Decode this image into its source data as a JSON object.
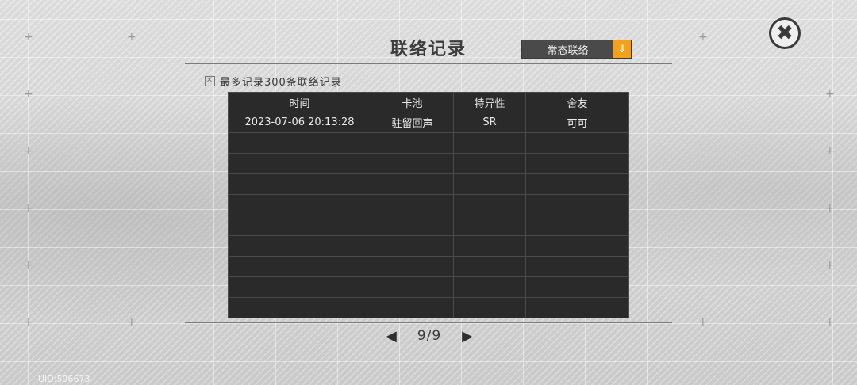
{
  "window": {
    "title": "联络记录"
  },
  "dropdown": {
    "selected": "常态联络",
    "arrow": "⇓"
  },
  "close": {
    "glyph": "✖"
  },
  "note": {
    "checkbox": "✕",
    "text": "最多记录300条联络记录"
  },
  "table": {
    "headers": [
      "时间",
      "卡池",
      "特异性",
      "舍友"
    ],
    "rows": [
      {
        "time": "2023-07-06 20:13:28",
        "pool": "驻留回声",
        "rarity": "SR",
        "roommate": "可可"
      }
    ],
    "empty_rows": 9
  },
  "pagination": {
    "prev": "◀",
    "page": "9/9",
    "next": "▶"
  },
  "uid": "UID:596673",
  "colors": {
    "accent": "#f2a21a",
    "sr": "#8a5cf0",
    "table_bg": "#2a2a2a"
  }
}
